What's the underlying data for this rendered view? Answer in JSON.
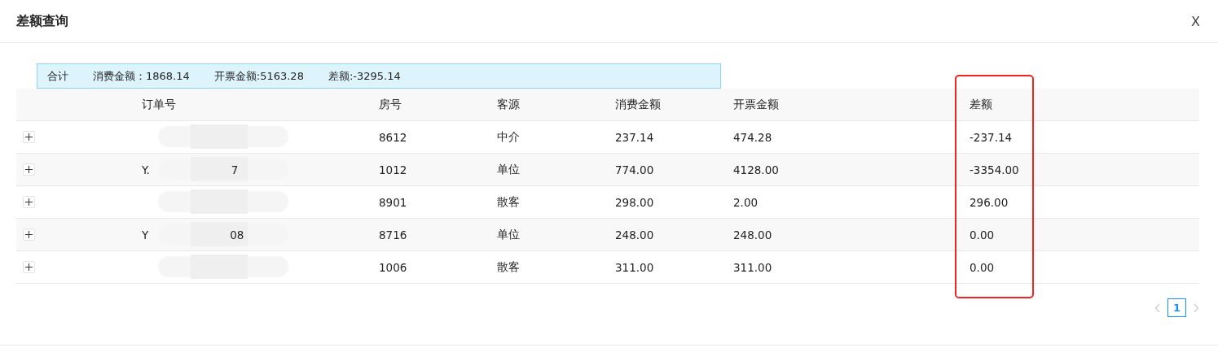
{
  "dialog": {
    "title": "差额查询",
    "close": "X"
  },
  "summary": [
    {
      "label": "合计"
    },
    {
      "label": "消费金额：1868.14"
    },
    {
      "label": "开票金额:5163.28"
    },
    {
      "label": "差额:-3295.14"
    }
  ],
  "table": {
    "columns": [
      {
        "label": "订单号",
        "highlighted": false
      },
      {
        "label": "房号",
        "highlighted": false
      },
      {
        "label": "客源",
        "highlighted": false
      },
      {
        "label": "消费金额",
        "highlighted": false
      },
      {
        "label": "开票金额",
        "highlighted": false
      },
      {
        "label": "差额",
        "highlighted": true
      }
    ],
    "rows": [
      {
        "expanded": false,
        "order_fragments": [],
        "room": "8612",
        "source": "中介",
        "spend": "237.14",
        "invoice": "474.28",
        "difference": "-237.14"
      },
      {
        "expanded": false,
        "order_fragments": [
          "Y.",
          "7"
        ],
        "room": "1012",
        "source": "单位",
        "spend": "774.00",
        "invoice": "4128.00",
        "difference": "-3354.00"
      },
      {
        "expanded": false,
        "order_fragments": [],
        "room": "8901",
        "source": "散客",
        "spend": "298.00",
        "invoice": "2.00",
        "difference": "296.00"
      },
      {
        "expanded": false,
        "order_fragments": [
          "Y",
          "08"
        ],
        "room": "8716",
        "source": "单位",
        "spend": "248.00",
        "invoice": "248.00",
        "difference": "0.00"
      },
      {
        "expanded": false,
        "order_fragments": [],
        "room": "1006",
        "source": "散客",
        "spend": "311.00",
        "invoice": "311.00",
        "difference": "0.00"
      }
    ]
  },
  "pagination": {
    "pages": [
      {
        "label": "1",
        "selected": true
      }
    ]
  }
}
